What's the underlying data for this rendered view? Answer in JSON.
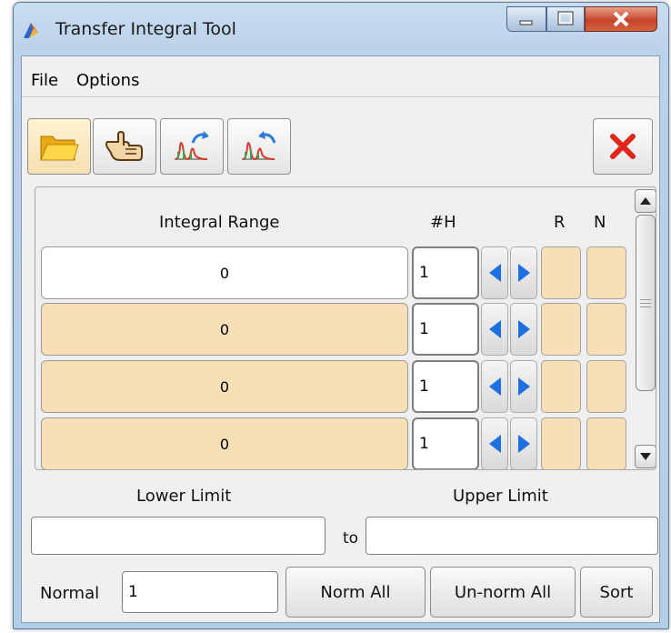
{
  "window": {
    "title": "Transfer Integral Tool",
    "controls": [
      "minimize-icon",
      "maximize-icon",
      "close-icon"
    ]
  },
  "menu": {
    "items": [
      {
        "label": "File"
      },
      {
        "label": "Options"
      }
    ]
  },
  "toolbar": {
    "buttons": [
      {
        "icon": "open-folder-icon"
      },
      {
        "icon": "pointing-hand-icon"
      },
      {
        "icon": "export-spectrum-icon"
      },
      {
        "icon": "import-spectrum-icon"
      }
    ],
    "close_icon": "red-x-icon"
  },
  "table": {
    "headers": {
      "range": "Integral Range",
      "h": "#H",
      "r": "R",
      "n": "N"
    },
    "rows": [
      {
        "range": "0",
        "h": "1"
      },
      {
        "range": "0",
        "h": "1"
      },
      {
        "range": "0",
        "h": "1"
      },
      {
        "range": "0",
        "h": "1"
      }
    ]
  },
  "limits": {
    "lower_label": "Lower Limit",
    "upper_label": "Upper Limit",
    "to_label": "to",
    "lower_value": "",
    "upper_value": ""
  },
  "bottom": {
    "normal_label": "Normal",
    "normal_value": "1",
    "norm_all": "Norm All",
    "unnorm_all": "Un-norm All",
    "sort": "Sort"
  },
  "colors": {
    "row_fill": "#f7dfb8",
    "arrow_blue": "#1e6fe0",
    "close_red": "#e0261b"
  }
}
